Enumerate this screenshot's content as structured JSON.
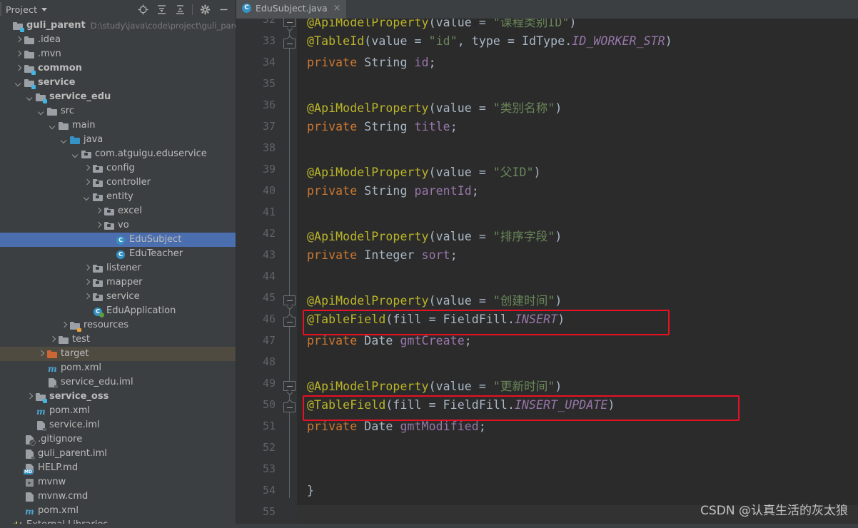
{
  "window": {
    "tool_window_title": "Project",
    "toolbar_icons": [
      "locate-target-icon",
      "expand-all-icon",
      "collapse-all-icon",
      "settings-gear-icon",
      "minimize-icon"
    ]
  },
  "editor_tabs": [
    {
      "label": "EduSubject.java",
      "icon": "java-class-icon",
      "close": "×",
      "active": true
    }
  ],
  "project_tree": [
    {
      "indent": 0,
      "arrow": "none",
      "icon": "module-folder-icon",
      "label": "guli_parent",
      "bold": true,
      "path": "D:\\study\\java\\code\\project\\guli_parent"
    },
    {
      "indent": 1,
      "arrow": "right",
      "icon": "folder-icon",
      "label": ".idea",
      "bold": false,
      "path": ""
    },
    {
      "indent": 1,
      "arrow": "right",
      "icon": "folder-icon",
      "label": ".mvn",
      "bold": false,
      "path": ""
    },
    {
      "indent": 1,
      "arrow": "right",
      "icon": "module-folder-icon",
      "label": "common",
      "bold": true,
      "path": ""
    },
    {
      "indent": 1,
      "arrow": "down",
      "icon": "module-folder-icon",
      "label": "service",
      "bold": true,
      "path": ""
    },
    {
      "indent": 2,
      "arrow": "down",
      "icon": "module-folder-icon",
      "label": "service_edu",
      "bold": true,
      "path": ""
    },
    {
      "indent": 3,
      "arrow": "down",
      "icon": "folder-icon",
      "label": "src",
      "bold": false,
      "path": ""
    },
    {
      "indent": 4,
      "arrow": "down",
      "icon": "folder-icon",
      "label": "main",
      "bold": false,
      "path": ""
    },
    {
      "indent": 5,
      "arrow": "down",
      "icon": "source-folder-icon",
      "label": "java",
      "bold": false,
      "path": ""
    },
    {
      "indent": 6,
      "arrow": "down",
      "icon": "package-icon",
      "label": "com.atguigu.eduservice",
      "bold": false,
      "path": ""
    },
    {
      "indent": 7,
      "arrow": "right",
      "icon": "package-icon",
      "label": "config",
      "bold": false,
      "path": ""
    },
    {
      "indent": 7,
      "arrow": "right",
      "icon": "package-icon",
      "label": "controller",
      "bold": false,
      "path": ""
    },
    {
      "indent": 7,
      "arrow": "down",
      "icon": "package-icon",
      "label": "entity",
      "bold": false,
      "path": ""
    },
    {
      "indent": 8,
      "arrow": "right",
      "icon": "package-icon",
      "label": "excel",
      "bold": false,
      "path": ""
    },
    {
      "indent": 8,
      "arrow": "right",
      "icon": "package-icon",
      "label": "vo",
      "bold": false,
      "path": ""
    },
    {
      "indent": 9,
      "arrow": "none",
      "icon": "java-class-icon",
      "label": "EduSubject",
      "bold": false,
      "path": "",
      "state": "selected"
    },
    {
      "indent": 9,
      "arrow": "none",
      "icon": "java-class-icon",
      "label": "EduTeacher",
      "bold": false,
      "path": ""
    },
    {
      "indent": 7,
      "arrow": "right",
      "icon": "package-icon",
      "label": "listener",
      "bold": false,
      "path": ""
    },
    {
      "indent": 7,
      "arrow": "right",
      "icon": "package-icon",
      "label": "mapper",
      "bold": false,
      "path": ""
    },
    {
      "indent": 7,
      "arrow": "right",
      "icon": "package-icon",
      "label": "service",
      "bold": false,
      "path": ""
    },
    {
      "indent": 7,
      "arrow": "none",
      "icon": "spring-boot-class-icon",
      "label": "EduApplication",
      "bold": false,
      "path": ""
    },
    {
      "indent": 5,
      "arrow": "right",
      "icon": "resources-folder-icon",
      "label": "resources",
      "bold": false,
      "path": ""
    },
    {
      "indent": 4,
      "arrow": "right",
      "icon": "folder-icon",
      "label": "test",
      "bold": false,
      "path": ""
    },
    {
      "indent": 3,
      "arrow": "right",
      "icon": "target-folder-icon",
      "label": "target",
      "bold": false,
      "path": "",
      "state": "excluded"
    },
    {
      "indent": 3,
      "arrow": "none",
      "icon": "maven-pom-icon",
      "label": "pom.xml",
      "bold": false,
      "path": ""
    },
    {
      "indent": 3,
      "arrow": "none",
      "icon": "iml-file-icon",
      "label": "service_edu.iml",
      "bold": false,
      "path": ""
    },
    {
      "indent": 2,
      "arrow": "right",
      "icon": "module-folder-icon",
      "label": "service_oss",
      "bold": true,
      "path": ""
    },
    {
      "indent": 2,
      "arrow": "none",
      "icon": "maven-pom-icon",
      "label": "pom.xml",
      "bold": false,
      "path": ""
    },
    {
      "indent": 2,
      "arrow": "none",
      "icon": "iml-file-icon",
      "label": "service.iml",
      "bold": false,
      "path": ""
    },
    {
      "indent": 1,
      "arrow": "none",
      "icon": "gitignore-file-icon",
      "label": ".gitignore",
      "bold": false,
      "path": ""
    },
    {
      "indent": 1,
      "arrow": "none",
      "icon": "iml-file-icon",
      "label": "guli_parent.iml",
      "bold": false,
      "path": ""
    },
    {
      "indent": 1,
      "arrow": "none",
      "icon": "markdown-file-icon",
      "label": "HELP.md",
      "bold": false,
      "path": ""
    },
    {
      "indent": 1,
      "arrow": "none",
      "icon": "shell-script-icon",
      "label": "mvnw",
      "bold": false,
      "path": ""
    },
    {
      "indent": 1,
      "arrow": "none",
      "icon": "cmd-script-icon",
      "label": "mvnw.cmd",
      "bold": false,
      "path": ""
    },
    {
      "indent": 1,
      "arrow": "none",
      "icon": "maven-pom-icon",
      "label": "pom.xml",
      "bold": false,
      "path": ""
    },
    {
      "indent": 0,
      "arrow": "none",
      "icon": "external-libraries-icon",
      "label": "External Libraries",
      "bold": false,
      "path": ""
    }
  ],
  "code": {
    "first_visible_line": 32,
    "last_visible_line": 55,
    "lines": [
      {
        "n": 32,
        "tokens": [
          {
            "t": "@ApiModelProperty",
            "c": "ann"
          },
          {
            "t": "(value = ",
            "c": "plain"
          },
          {
            "t": "\"课程类别ID\"",
            "c": "str"
          },
          {
            "t": ")",
            "c": "plain"
          }
        ]
      },
      {
        "n": 33,
        "tokens": [
          {
            "t": "@TableId",
            "c": "ann"
          },
          {
            "t": "(value = ",
            "c": "plain"
          },
          {
            "t": "\"id\"",
            "c": "str"
          },
          {
            "t": ", type = IdType.",
            "c": "plain"
          },
          {
            "t": "ID_WORKER_STR",
            "c": "stat"
          },
          {
            "t": ")",
            "c": "plain"
          }
        ]
      },
      {
        "n": 34,
        "tokens": [
          {
            "t": "private",
            "c": "kw"
          },
          {
            "t": " String ",
            "c": "plain"
          },
          {
            "t": "id",
            "c": "fld"
          },
          {
            "t": ";",
            "c": "plain"
          }
        ]
      },
      {
        "n": 35,
        "tokens": []
      },
      {
        "n": 36,
        "tokens": [
          {
            "t": "@ApiModelProperty",
            "c": "ann"
          },
          {
            "t": "(value = ",
            "c": "plain"
          },
          {
            "t": "\"类别名称\"",
            "c": "str"
          },
          {
            "t": ")",
            "c": "plain"
          }
        ]
      },
      {
        "n": 37,
        "tokens": [
          {
            "t": "private",
            "c": "kw"
          },
          {
            "t": " String ",
            "c": "plain"
          },
          {
            "t": "title",
            "c": "fld"
          },
          {
            "t": ";",
            "c": "plain"
          }
        ]
      },
      {
        "n": 38,
        "tokens": []
      },
      {
        "n": 39,
        "tokens": [
          {
            "t": "@ApiModelProperty",
            "c": "ann"
          },
          {
            "t": "(value = ",
            "c": "plain"
          },
          {
            "t": "\"父ID\"",
            "c": "str"
          },
          {
            "t": ")",
            "c": "plain"
          }
        ]
      },
      {
        "n": 40,
        "tokens": [
          {
            "t": "private",
            "c": "kw"
          },
          {
            "t": " String ",
            "c": "plain"
          },
          {
            "t": "parentId",
            "c": "fld"
          },
          {
            "t": ";",
            "c": "plain"
          }
        ]
      },
      {
        "n": 41,
        "tokens": []
      },
      {
        "n": 42,
        "tokens": [
          {
            "t": "@ApiModelProperty",
            "c": "ann"
          },
          {
            "t": "(value = ",
            "c": "plain"
          },
          {
            "t": "\"排序字段\"",
            "c": "str"
          },
          {
            "t": ")",
            "c": "plain"
          }
        ]
      },
      {
        "n": 43,
        "tokens": [
          {
            "t": "private",
            "c": "kw"
          },
          {
            "t": " Integer ",
            "c": "plain"
          },
          {
            "t": "sort",
            "c": "fld"
          },
          {
            "t": ";",
            "c": "plain"
          }
        ]
      },
      {
        "n": 44,
        "tokens": []
      },
      {
        "n": 45,
        "tokens": [
          {
            "t": "@ApiModelProperty",
            "c": "ann"
          },
          {
            "t": "(value = ",
            "c": "plain"
          },
          {
            "t": "\"创建时间\"",
            "c": "str"
          },
          {
            "t": ")",
            "c": "plain"
          }
        ]
      },
      {
        "n": 46,
        "tokens": [
          {
            "t": "@TableField",
            "c": "ann"
          },
          {
            "t": "(fill = FieldFill.",
            "c": "plain"
          },
          {
            "t": "INSERT",
            "c": "stat"
          },
          {
            "t": ")",
            "c": "plain"
          }
        ]
      },
      {
        "n": 47,
        "tokens": [
          {
            "t": "private",
            "c": "kw"
          },
          {
            "t": " Date ",
            "c": "plain"
          },
          {
            "t": "gmtCreate",
            "c": "fld"
          },
          {
            "t": ";",
            "c": "plain"
          }
        ]
      },
      {
        "n": 48,
        "tokens": []
      },
      {
        "n": 49,
        "tokens": [
          {
            "t": "@ApiModelProperty",
            "c": "ann"
          },
          {
            "t": "(value = ",
            "c": "plain"
          },
          {
            "t": "\"更新时间\"",
            "c": "str"
          },
          {
            "t": ")",
            "c": "plain"
          }
        ]
      },
      {
        "n": 50,
        "tokens": [
          {
            "t": "@TableField",
            "c": "ann"
          },
          {
            "t": "(fill = FieldFill.",
            "c": "plain"
          },
          {
            "t": "INSERT_UPDATE",
            "c": "stat"
          },
          {
            "t": ")",
            "c": "plain"
          }
        ]
      },
      {
        "n": 51,
        "tokens": [
          {
            "t": "private",
            "c": "kw"
          },
          {
            "t": " Date ",
            "c": "plain"
          },
          {
            "t": "gmtModified",
            "c": "fld"
          },
          {
            "t": ";",
            "c": "plain"
          }
        ]
      },
      {
        "n": 52,
        "tokens": []
      },
      {
        "n": 53,
        "tokens": []
      },
      {
        "n": 54,
        "tokens": [
          {
            "t": "}",
            "c": "plain"
          }
        ]
      },
      {
        "n": 55,
        "tokens": []
      }
    ],
    "annotation_boxes": [
      {
        "line": 46,
        "label": "highlight-box-insert"
      },
      {
        "line": 50,
        "label": "highlight-box-insert-update"
      }
    ],
    "fold_regions": [
      {
        "start": 32,
        "end": 33
      },
      {
        "start": 45,
        "end": 46
      },
      {
        "start": 49,
        "end": 50
      }
    ]
  },
  "watermark": "CSDN @认真生活的灰太狼",
  "colors": {
    "editor_bg": "#2B2B2B",
    "gutter_bg": "#313335",
    "panel_bg": "#3C3F41",
    "selection": "#4B6EAF",
    "excluded": "#4F4B41",
    "annotation": "#BBB529",
    "keyword": "#CC7832",
    "string": "#6A8759",
    "field": "#9876AA",
    "plain": "#A9B7C6",
    "box_border": "#E81123"
  }
}
